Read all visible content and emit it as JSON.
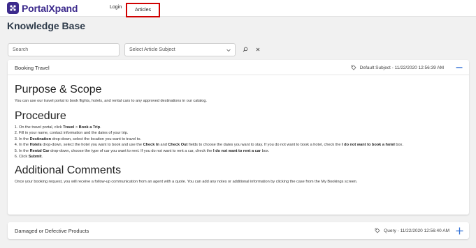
{
  "app": {
    "brand": "PortalXpand",
    "nav": [
      {
        "label": "Login"
      },
      {
        "label": "Articles",
        "highlighted": true
      }
    ]
  },
  "page": {
    "title": "Knowledge Base"
  },
  "filters": {
    "search_placeholder": "Search",
    "subject_select_value": "Select Article Subject"
  },
  "articles": [
    {
      "title": "Booking Travel",
      "meta": "Default Subject - 11/22/2020 12:56:39 AM",
      "expanded": true,
      "toggle_icon": "minus-icon",
      "sections": {
        "purpose_heading": "Purpose & Scope",
        "purpose_text": "You can use our travel portal to book flights, hotels, and rental cars to any approved destinations in our catalog.",
        "procedure_heading": "Procedure",
        "steps": [
          {
            "p1": "On the travel portal, click ",
            "b1": "Travel",
            "p2": " > ",
            "b2": "Book a Trip",
            "p3": "."
          },
          {
            "p1": "Fill in your name, contact information and the dates of your trip."
          },
          {
            "p1": "In the ",
            "b1": "Destination",
            "p2": " drop-down, select the location you want to travel to."
          },
          {
            "p1": "In the ",
            "b1": "Hotels",
            "p2": " drop-down, select the hotel you want to book and use the ",
            "b2": "Check In",
            "p3": " and ",
            "b3": "Check Out",
            "p4": " fields to choose the dates you want to stay. If you do not want to book a hotel, check the ",
            "b4": "I do not want to book a hotel",
            "p5": " box."
          },
          {
            "p1": "In the ",
            "b1": "Rental Car",
            "p2": " drop-down, choose the type of car you want to rent. If you do not want to rent a car, check the ",
            "b2": "I do not want to rent a car",
            "p3": " box."
          },
          {
            "p1": "Click ",
            "b1": "Submit",
            "p2": "."
          }
        ],
        "additional_heading": "Additional Comments",
        "additional_text": "Once your booking request, you will receive a follow-up communication from an agent with a quote. You can add any notes or additional information by clicking the case from the My Bookings screen."
      }
    },
    {
      "title": "Damaged or Defective Products",
      "meta": "Query - 11/22/2020 12:56:40 AM",
      "expanded": false,
      "toggle_icon": "plus-icon"
    }
  ],
  "colors": {
    "brand": "#3c2a8c",
    "accent": "#2f6fd6",
    "highlight_border": "#d00000",
    "background": "#f1f1f1"
  }
}
